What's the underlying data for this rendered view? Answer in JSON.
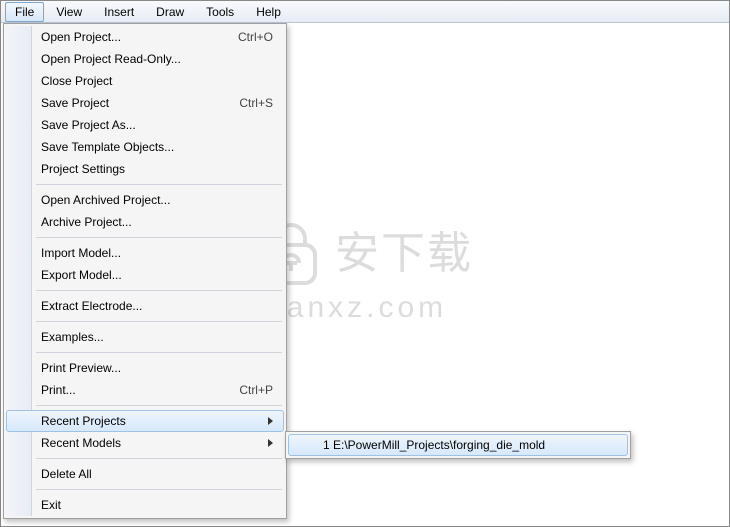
{
  "menubar": {
    "file": "File",
    "view": "View",
    "insert": "Insert",
    "draw": "Draw",
    "tools": "Tools",
    "help": "Help"
  },
  "file_menu": {
    "open_project": "Open Project...",
    "open_project_sc": "Ctrl+O",
    "open_readonly": "Open Project Read-Only...",
    "close_project": "Close Project",
    "save_project": "Save Project",
    "save_project_sc": "Ctrl+S",
    "save_project_as": "Save Project As...",
    "save_template": "Save Template Objects...",
    "project_settings": "Project Settings",
    "open_archived": "Open Archived Project...",
    "archive_project": "Archive Project...",
    "import_model": "Import Model...",
    "export_model": "Export Model...",
    "extract_electrode": "Extract Electrode...",
    "examples": "Examples...",
    "print_preview": "Print Preview...",
    "print": "Print...",
    "print_sc": "Ctrl+P",
    "recent_projects": "Recent Projects",
    "recent_models": "Recent Models",
    "delete_all": "Delete All",
    "exit": "Exit"
  },
  "recent_projects_submenu": {
    "item1": "1 E:\\PowerMill_Projects\\forging_die_mold"
  },
  "watermark": {
    "cn": "安下载",
    "url": "anxz.com"
  }
}
